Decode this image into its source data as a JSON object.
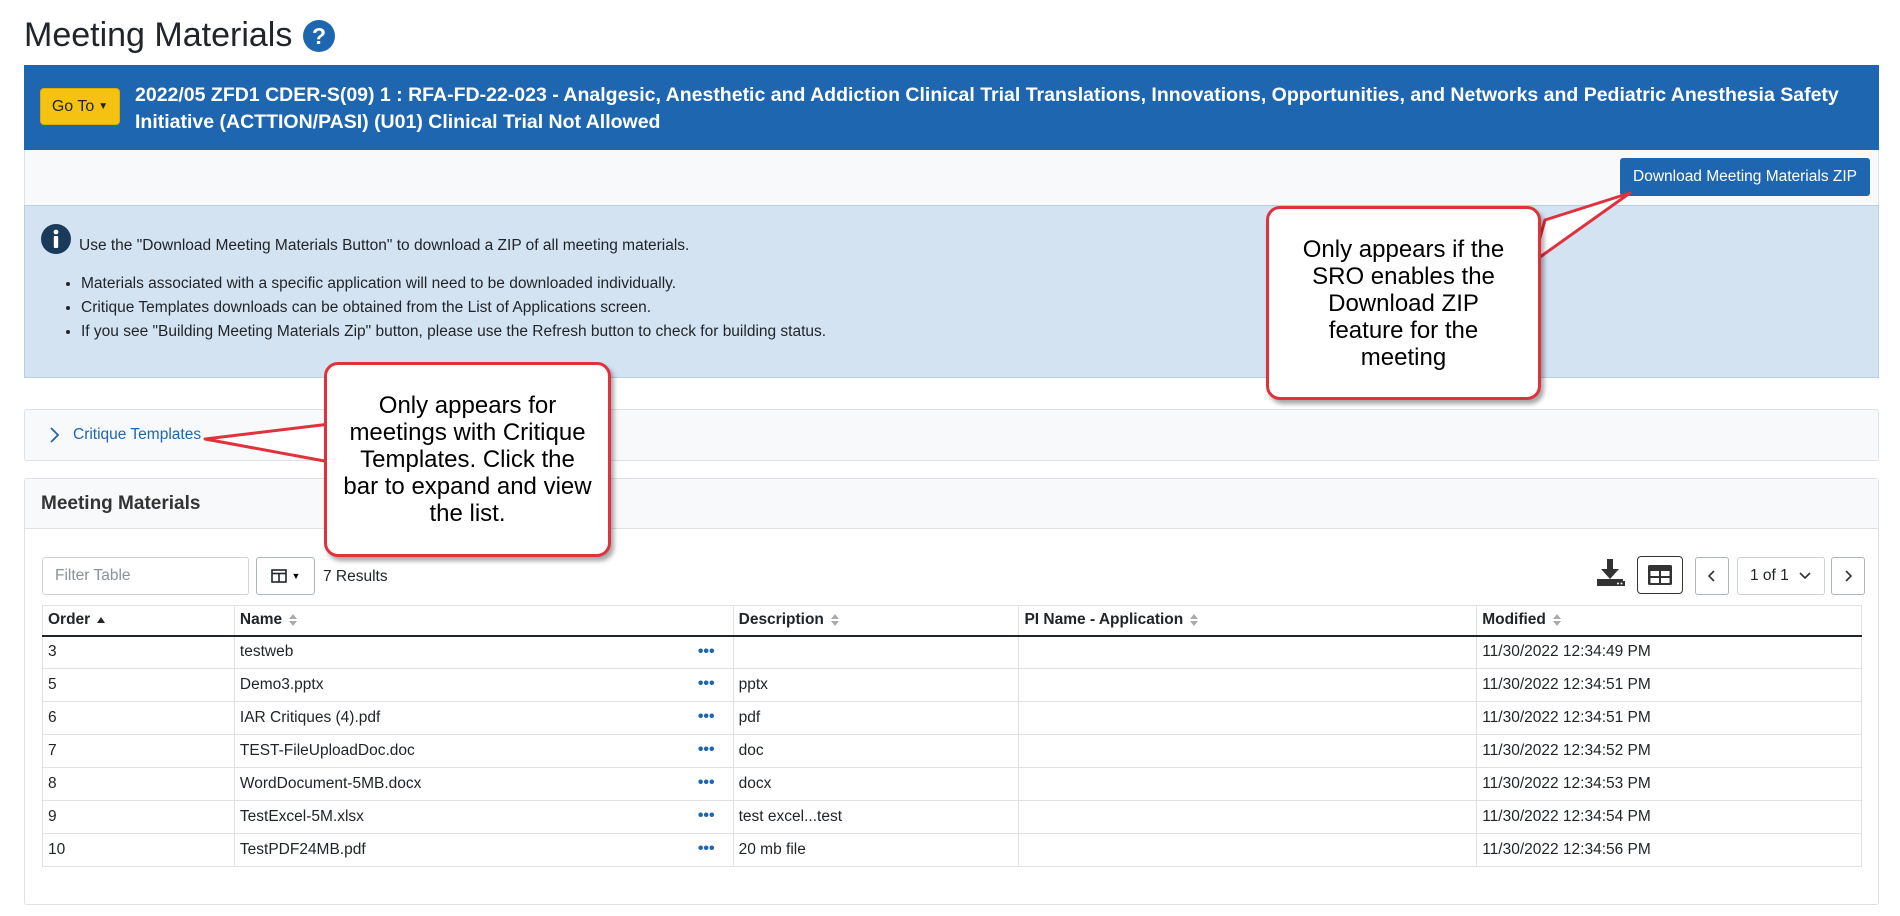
{
  "page": {
    "title": "Meeting Materials",
    "help_icon": "question-circle-icon"
  },
  "meeting_bar": {
    "goto_label": "Go To",
    "title": "2022/05 ZFD1 CDER-S(09) 1 : RFA-FD-22-023 - Analgesic, Anesthetic and Addiction Clinical Trial Translations, Innovations, Opportunities, and Networks and Pediatric Anesthesia Safety Initiative (ACTTION/PASI) (U01) Clinical Trial Not Allowed"
  },
  "actions": {
    "download_zip_label": "Download Meeting Materials ZIP"
  },
  "info": {
    "lead": "Use the \"Download Meeting Materials Button\" to download a ZIP of all meeting materials.",
    "items": [
      "Materials associated with a specific application will need to be downloaded individually.",
      "Critique Templates downloads can be obtained from the List of Applications screen.",
      "If you see \"Building Meeting Materials Zip\" button, please use the Refresh button to check for building status."
    ]
  },
  "critique": {
    "label": "Critique Templates"
  },
  "materials": {
    "heading": "Meeting Materials",
    "filter_placeholder": "Filter Table",
    "results": "7 Results",
    "pagination": "1 of 1",
    "columns": [
      "Order",
      "Name",
      "Description",
      "PI Name - Application",
      "Modified"
    ],
    "rows": [
      {
        "order": "3",
        "name": "testweb",
        "description": "",
        "pi": "",
        "modified": "11/30/2022 12:34:49 PM"
      },
      {
        "order": "5",
        "name": "Demo3.pptx",
        "description": "pptx",
        "pi": "",
        "modified": "11/30/2022 12:34:51 PM"
      },
      {
        "order": "6",
        "name": "IAR Critiques (4).pdf",
        "description": "pdf",
        "pi": "",
        "modified": "11/30/2022 12:34:51 PM"
      },
      {
        "order": "7",
        "name": "TEST-FileUploadDoc.doc",
        "description": "doc",
        "pi": "",
        "modified": "11/30/2022 12:34:52 PM"
      },
      {
        "order": "8",
        "name": "WordDocument-5MB.docx",
        "description": "docx",
        "pi": "",
        "modified": "11/30/2022 12:34:53 PM"
      },
      {
        "order": "9",
        "name": "TestExcel-5M.xlsx",
        "description": "test excel...test",
        "pi": "",
        "modified": "11/30/2022 12:34:54 PM"
      },
      {
        "order": "10",
        "name": "TestPDF24MB.pdf",
        "description": "20 mb file",
        "pi": "",
        "modified": "11/30/2022 12:34:56 PM"
      }
    ],
    "row_menu_glyph": "•••"
  },
  "callouts": {
    "zip": "Only appears if the SRO enables the Download ZIP feature for the meeting",
    "critique": "Only appears for meetings with Critique Templates. Click the bar to expand and view the list."
  },
  "colors": {
    "primary": "#1f66b1",
    "goto": "#f5c211",
    "info_bg": "#d4e3f2",
    "callout_border": "#e0323c"
  }
}
